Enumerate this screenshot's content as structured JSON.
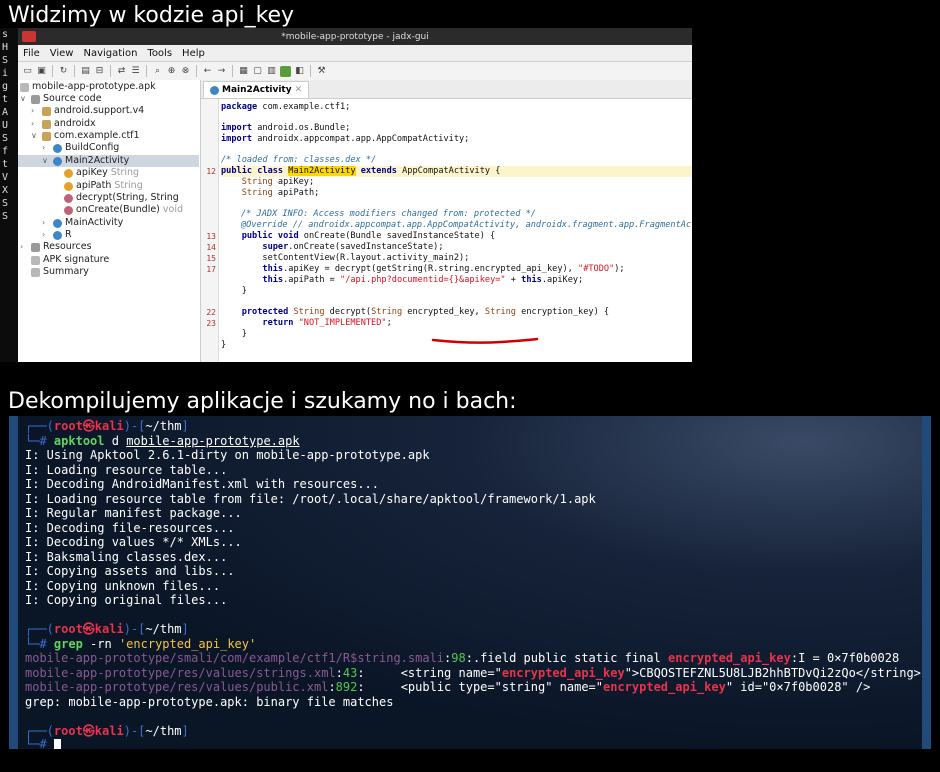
{
  "captions": {
    "top": "Widzimy w kodzie api_key",
    "middle": "Dekompilujemy aplikacje i szukamy no i bach:"
  },
  "background_terminal": {
    "chars": [
      "s",
      "H",
      "S",
      "i",
      "g",
      "t",
      "A",
      "U",
      "S",
      "f",
      "t",
      "V",
      "X",
      "S",
      "S"
    ]
  },
  "jadx": {
    "window_title": "*mobile-app-prototype - jadx-gui",
    "menu": [
      "File",
      "View",
      "Navigation",
      "Tools",
      "Help"
    ],
    "tree": {
      "root": "mobile-app-prototype.apk",
      "source_code": "Source code",
      "pkg_support": "android.support.v4",
      "pkg_androidx": "androidx",
      "pkg_ctf": "com.example.ctf1",
      "build_config": "BuildConfig",
      "main2": "Main2Activity",
      "field_apikey": "apiKey",
      "field_apikey_type": "String",
      "field_apipath": "apiPath",
      "field_apipath_type": "String",
      "method_decrypt": "decrypt(String, String",
      "method_oncreate": "onCreate(Bundle)",
      "method_oncreate_type": "void",
      "main_activity": "MainActivity",
      "r": "R",
      "resources": "Resources",
      "apk_signature": "APK signature",
      "summary": "Summary"
    },
    "tab": "Main2Activity",
    "code": {
      "pkg": "package com.example.ctf1;",
      "imp1": "import android.os.Bundle;",
      "imp2": "import androidx.appcompat.app.AppCompatActivity;",
      "cm1": "/* loaded from: classes.dex */",
      "ln12": "12",
      "cls_kw": "public class ",
      "cls_name": "Main2Activity",
      "cls_ext": " extends ",
      "cls_parent": "AppCompatActivity {",
      "f1_type": "String",
      "f1": " apiKey;",
      "f2_type": "String",
      "f2": " apiPath;",
      "cm2": "/* JADX INFO: Access modifiers changed from: protected */",
      "cm3": "@Override // androidx.appcompat.app.AppCompatActivity, androidx.fragment.app.FragmentActiv",
      "ln13": "13",
      "oc_kw": "public void ",
      "oc": "onCreate(Bundle savedInstanceState) {",
      "ln14": "14",
      "sup_kw": "super",
      "sup": ".onCreate(savedInstanceState);",
      "ln15": "15",
      "scv": "setContentView(R.layout.activity_main2);",
      "ln17": "17",
      "this1_kw": "this",
      "this1_a": ".apiKey = decrypt(getString(R.string.encrypted_api_key), ",
      "this1_str": "\"#TODO\"",
      "this1_b": ");",
      "this2_kw": "this",
      "this2_a": ".apiPath = ",
      "this2_str": "\"/api.php?documentid={}&apikey=\"",
      "this2_b": " + ",
      "this2_kw2": "this",
      "this2_c": ".apiKey;",
      "close1": "}",
      "ln22": "22",
      "dec_kw": "protected ",
      "dec_type": "String",
      "dec_a": " decrypt(",
      "dec_t1": "String",
      "dec_b": " encrypted_key, ",
      "dec_t2": "String",
      "dec_c": " encryption_key) {",
      "ln23": "23",
      "ret_kw": "return ",
      "ret_str": "\"NOT_IMPLEMENTED\"",
      "ret_end": ";",
      "close2": "}",
      "close3": "}"
    }
  },
  "terminal": {
    "prompt_open": "┌──(",
    "prompt_user": "root㉿kali",
    "prompt_mid": ")-[",
    "prompt_path": "~/thm",
    "prompt_close": "]",
    "prompt_hash": "└─#",
    "cmd1_tool": "apktool",
    "cmd1_arg1": " d ",
    "cmd1_file": "mobile-app-prototype.apk",
    "apktool_output": [
      "I: Using Apktool 2.6.1-dirty on mobile-app-prototype.apk",
      "I: Loading resource table...",
      "I: Decoding AndroidManifest.xml with resources...",
      "I: Loading resource table from file: /root/.local/share/apktool/framework/1.apk",
      "I: Regular manifest package...",
      "I: Decoding file-resources...",
      "I: Decoding values */* XMLs...",
      "I: Baksmaling classes.dex...",
      "I: Copying assets and libs...",
      "I: Copying unknown files...",
      "I: Copying original files..."
    ],
    "cmd2_tool": "grep",
    "cmd2_flags": " -rn ",
    "cmd2_pattern": "'encrypted_api_key'",
    "grep1_path": "mobile-app-prototype/smali/com/example/ctf1/R$string.smali",
    "grep1_num": "98",
    "grep1_a": ":.field public static final ",
    "grep1_match": "encrypted_api_key",
    "grep1_b": ":I = 0×7f0b0028",
    "grep2_path": "mobile-app-prototype/res/values/strings.xml",
    "grep2_num": "43",
    "grep2_a": ":     <string name=\"",
    "grep2_match": "encrypted_api_key",
    "grep2_b": "\">CBQOSTEFZNL5U8LJB2hhBTDvQi2zQo</string>",
    "grep3_path": "mobile-app-prototype/res/values/public.xml",
    "grep3_num": "892",
    "grep3_a": ":     <public type=\"string\" name=\"",
    "grep3_match": "encrypted_api_key",
    "grep3_b": "\" id=\"0×7f0b0028\" />",
    "grep4": "grep: mobile-app-prototype.apk: binary file matches"
  },
  "colors": {
    "kali_red": "#e8334c",
    "kali_blue": "#3b6fd1",
    "command_green": "#5fd75f",
    "grep_path_purple": "#8a5a8f",
    "highlight_yellow": "#ffd700",
    "underline_red": "#d00000"
  }
}
